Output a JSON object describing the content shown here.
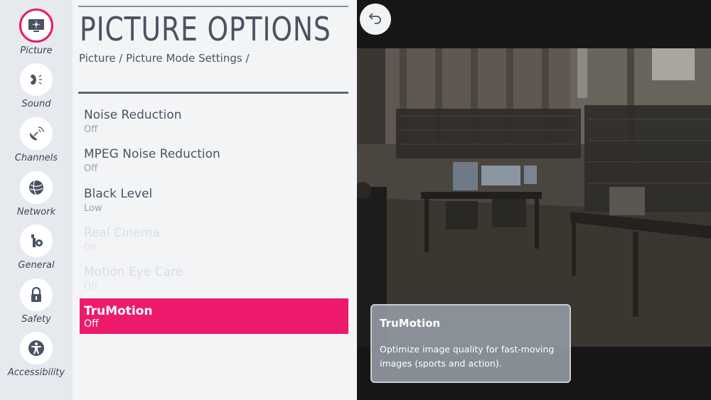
{
  "sidebar": {
    "items": [
      {
        "label": "Picture",
        "icon": "picture-icon",
        "active": true
      },
      {
        "label": "Sound",
        "icon": "sound-icon"
      },
      {
        "label": "Channels",
        "icon": "satellite-dish-icon"
      },
      {
        "label": "Network",
        "icon": "globe-icon"
      },
      {
        "label": "General",
        "icon": "gear-wrench-icon"
      },
      {
        "label": "Safety",
        "icon": "lock-icon"
      },
      {
        "label": "Accessibility",
        "icon": "accessibility-icon"
      }
    ]
  },
  "panel": {
    "title": "PICTURE OPTIONS",
    "breadcrumb": "Picture / Picture Mode Settings /",
    "items": [
      {
        "name": "Noise Reduction",
        "value": "Off",
        "state": "normal"
      },
      {
        "name": "MPEG Noise Reduction",
        "value": "Off",
        "state": "normal"
      },
      {
        "name": "Black Level",
        "value": "Low",
        "state": "normal"
      },
      {
        "name": "Real Cinema",
        "value": "On",
        "state": "disabled"
      },
      {
        "name": "Motion Eye Care",
        "value": "Off",
        "state": "disabled"
      },
      {
        "name": "TruMotion",
        "value": "Off",
        "state": "selected"
      }
    ]
  },
  "tooltip": {
    "title": "TruMotion",
    "description": "Optimize image quality for fast-moving images (sports and action)."
  },
  "colors": {
    "accent": "#ed1a6d",
    "sidebar_bg": "#e6e9ee",
    "panel_bg": "#f3f4f6",
    "text": "#4b5260"
  },
  "back_button_icon": "back-arrow-icon"
}
